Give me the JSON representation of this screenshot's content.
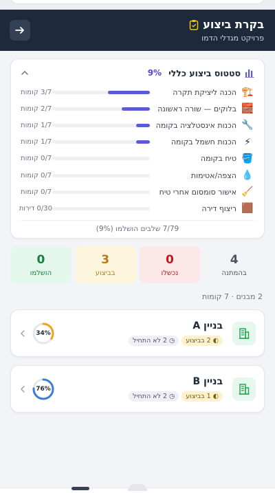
{
  "header": {
    "title": "בקרת ביצוע",
    "subtitle": "פרויקט מגדלי הדמו"
  },
  "status": {
    "title": "סטטוס ביצוע כללי",
    "percent": "9%",
    "steps": [
      {
        "emoji": "🏗️",
        "label": "הכנה ליציקת תקרה",
        "count": "3/7 קומות",
        "progress": 0.43
      },
      {
        "emoji": "🧱",
        "label": "בלוקים — שורה ראשונה",
        "count": "2/7 קומות",
        "progress": 0.29
      },
      {
        "emoji": "🔧",
        "label": "הכנות אינסטלציה בקומה",
        "count": "1/7 קומות",
        "progress": 0.14
      },
      {
        "emoji": "⚡",
        "label": "הכנות חשמל בקומה",
        "count": "1/7 קומות",
        "progress": 0.14
      },
      {
        "emoji": "🪣",
        "label": "טיח בקומה",
        "count": "0/7 קומות",
        "progress": 0
      },
      {
        "emoji": "💧",
        "label": "הצפה/אטימות",
        "count": "0/7 קומות",
        "progress": 0
      },
      {
        "emoji": "🧹",
        "label": "אישור סומסום אחרי טיח",
        "count": "0/7 קומות",
        "progress": 0
      },
      {
        "emoji": "🟫",
        "label": "ריצוף דירה",
        "count": "0/30 דירות",
        "progress": 0
      }
    ],
    "footer": "7/79 שלבים הושלמו (9%)"
  },
  "stats": [
    {
      "num": "4",
      "label": "בהמתנה",
      "bg": "#f3f4f6",
      "color": "#4b5563"
    },
    {
      "num": "0",
      "label": "נכשלו",
      "bg": "#fde8e8",
      "color": "#b91c1c"
    },
    {
      "num": "3",
      "label": "בביצוע",
      "bg": "#fdf6dc",
      "color": "#b7791f"
    },
    {
      "num": "0",
      "label": "הושלמו",
      "bg": "#e3f7ec",
      "color": "#15803d"
    }
  ],
  "meta": "2 מבנים · 7 קומות",
  "buildings": [
    {
      "name": "בניין A",
      "in_progress": "2 בביצוע",
      "not_started": "2 לא התחיל",
      "percent": "34%",
      "progress": 0.34,
      "ring_color": "#f0a21b"
    },
    {
      "name": "בניין B",
      "in_progress": "1 בביצוע",
      "not_started": "2 לא התחיל",
      "percent": "76%",
      "progress": 0.76,
      "ring_color": "#3b7dd8"
    }
  ],
  "colors": {
    "accent": "#4f46e5",
    "header_bg": "#1e293b",
    "bar_fill": "#5b5bd6"
  }
}
